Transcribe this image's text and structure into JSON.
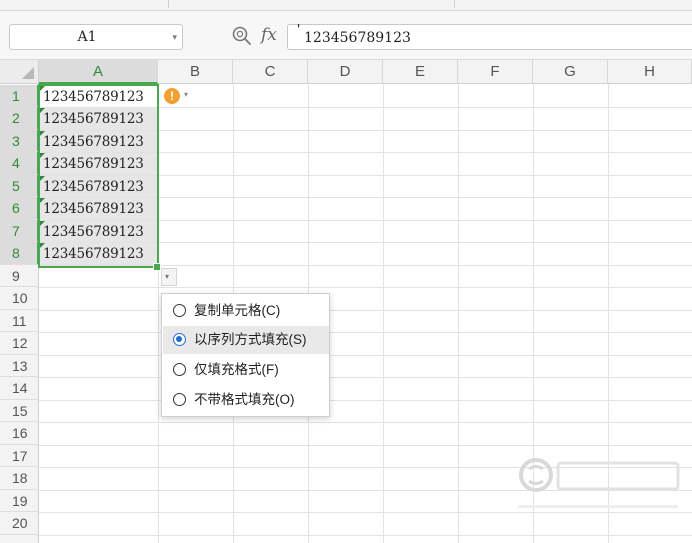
{
  "formula_bar": {
    "cell_ref": "A1",
    "fx_label": "fx",
    "formula_apostrophe": "'",
    "formula_value": "123456789123"
  },
  "columns": [
    "A",
    "B",
    "C",
    "D",
    "E",
    "F",
    "G",
    "H"
  ],
  "rows": [
    "1",
    "2",
    "3",
    "4",
    "5",
    "6",
    "7",
    "8",
    "9",
    "10",
    "11",
    "12",
    "13",
    "14",
    "15",
    "16",
    "17",
    "18",
    "19",
    "20"
  ],
  "cells": {
    "A1": "123456789123",
    "A2": "123456789123",
    "A3": "123456789123",
    "A4": "123456789123",
    "A5": "123456789123",
    "A6": "123456789123",
    "A7": "123456789123",
    "A8": "123456789123"
  },
  "warning_icon": "!",
  "autofill_menu": {
    "items": [
      {
        "label": "复制单元格(C)",
        "selected": false
      },
      {
        "label": "以序列方式填充(S)",
        "selected": true
      },
      {
        "label": "仅填充格式(F)",
        "selected": false
      },
      {
        "label": "不带格式填充(O)",
        "selected": false
      }
    ]
  },
  "colors": {
    "selection_accent": "#4aa74f",
    "radio_selected": "#1f6fd1",
    "warning": "#f0a030"
  },
  "icons": {
    "zoom": "zoom-magnifier-icon",
    "warning": "warning-icon",
    "dropdown": "chevron-down-icon"
  }
}
